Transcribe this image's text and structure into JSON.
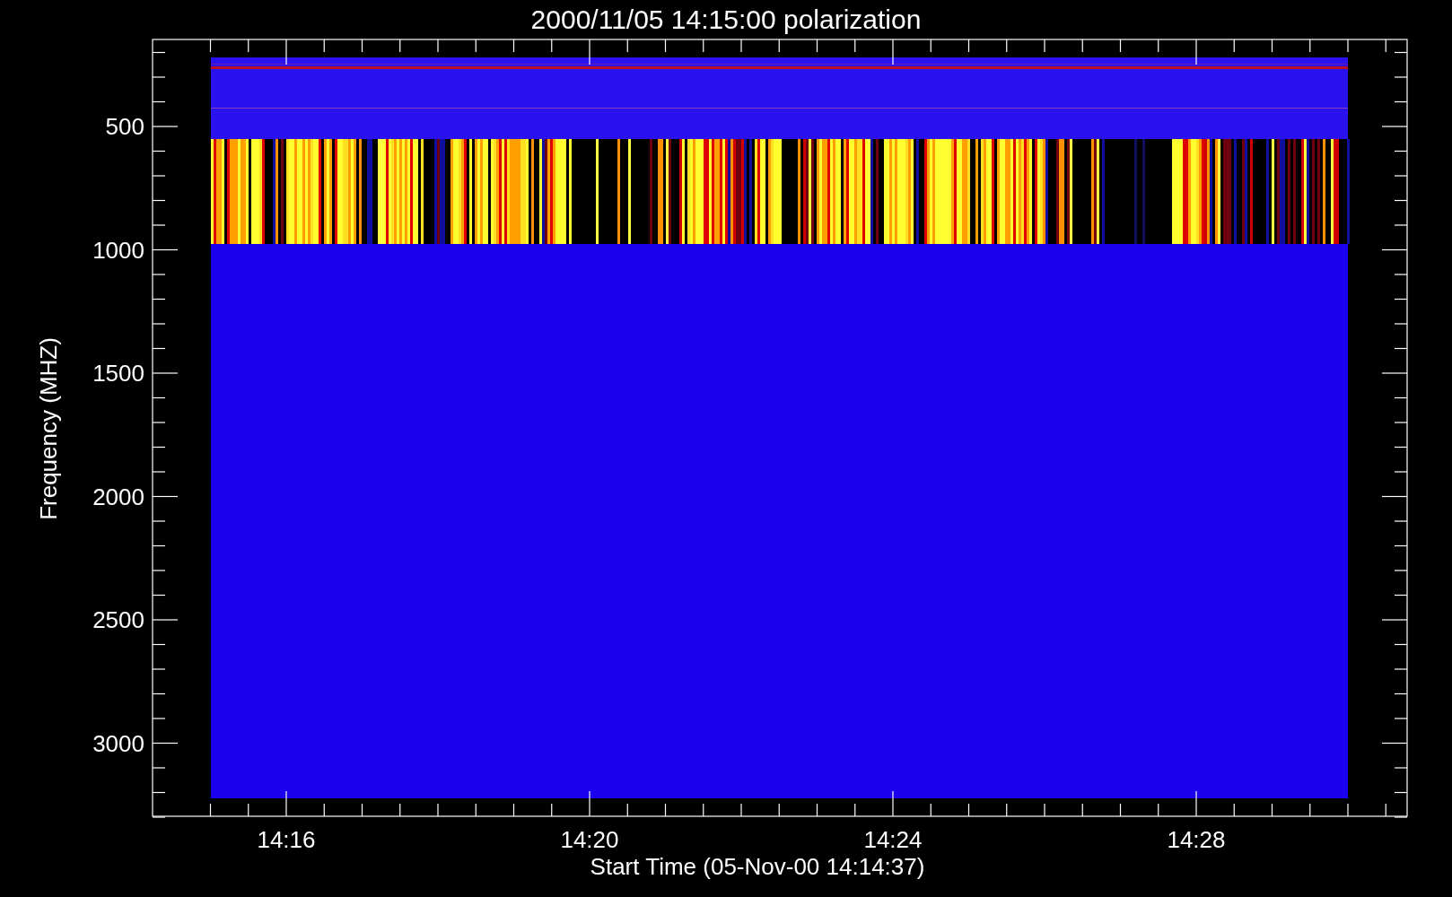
{
  "title": "2000/11/05 14:15:00 polarization",
  "plot": {
    "ylabel": "Frequency (MHZ)",
    "yticks": [
      "500",
      "1000",
      "1500",
      "2000",
      "2500",
      "3000"
    ],
    "xticks": [
      "14:16",
      "14:20",
      "14:24",
      "14:28"
    ],
    "xlabel": "Start Time (05-Nov-00 14:14:37)"
  }
}
